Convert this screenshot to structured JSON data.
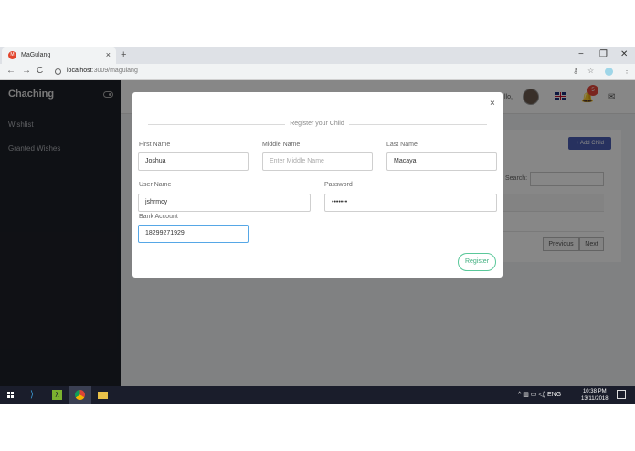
{
  "browser": {
    "tab_title": "MaGulang",
    "tab_close": "×",
    "new_tab": "+",
    "url_host": "localhost",
    "url_path": ":3009/magulang",
    "win_minimize": "−",
    "win_restore": "❐",
    "win_close": "✕"
  },
  "app": {
    "brand": "Chaching",
    "nav": [
      "Wishlist",
      "Granted Wishes"
    ],
    "topbar_hello": "llo,",
    "notification_count": "5",
    "add_child_label": "+ Add Child",
    "search_label": "Search:",
    "prev_label": "Previous",
    "next_label": "Next"
  },
  "modal": {
    "title": "Register your Child",
    "close": "×",
    "first_name_label": "First Name",
    "first_name_value": "Joshua",
    "middle_name_label": "Middle Name",
    "middle_name_placeholder": "Enter Middle Name",
    "last_name_label": "Last Name",
    "last_name_value": "Macaya",
    "username_label": "User Name",
    "username_value": "jshrmcy",
    "password_label": "Password",
    "password_value": "•••••••",
    "bank_label": "Bank Account",
    "bank_value": "18299271929",
    "register_label": "Register"
  },
  "taskbar": {
    "lang": "ENG",
    "time": "10:38 PM",
    "date": "13/11/2018"
  },
  "colors": {
    "sidebar": "#1e2128",
    "accent": "#4a5eb4",
    "register_green": "#3fae7e",
    "focus_blue": "#56a7e6"
  }
}
